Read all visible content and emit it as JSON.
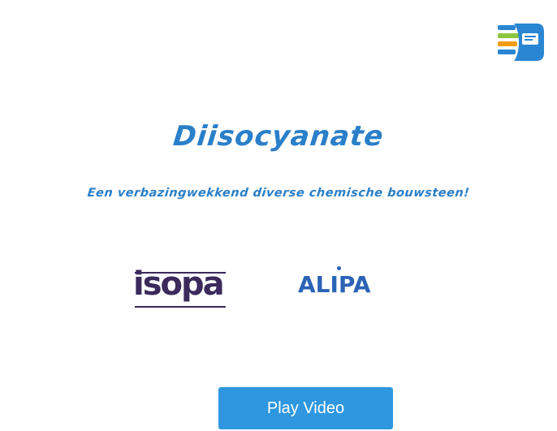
{
  "video": {
    "title": "Diisocyanate",
    "subtitle": "Een verbazingwekkend diverse chemische bouwsteen!",
    "logos": {
      "corner": "corner-brand-logo",
      "isopa": "isopa",
      "alipa": "ALIPA"
    },
    "colors": {
      "title": "#2a7fc9",
      "isopa": "#3b2a5c",
      "alipa": "#2b63b5",
      "button": "#2e97df"
    }
  },
  "controls": {
    "play_label": "Play Video"
  }
}
